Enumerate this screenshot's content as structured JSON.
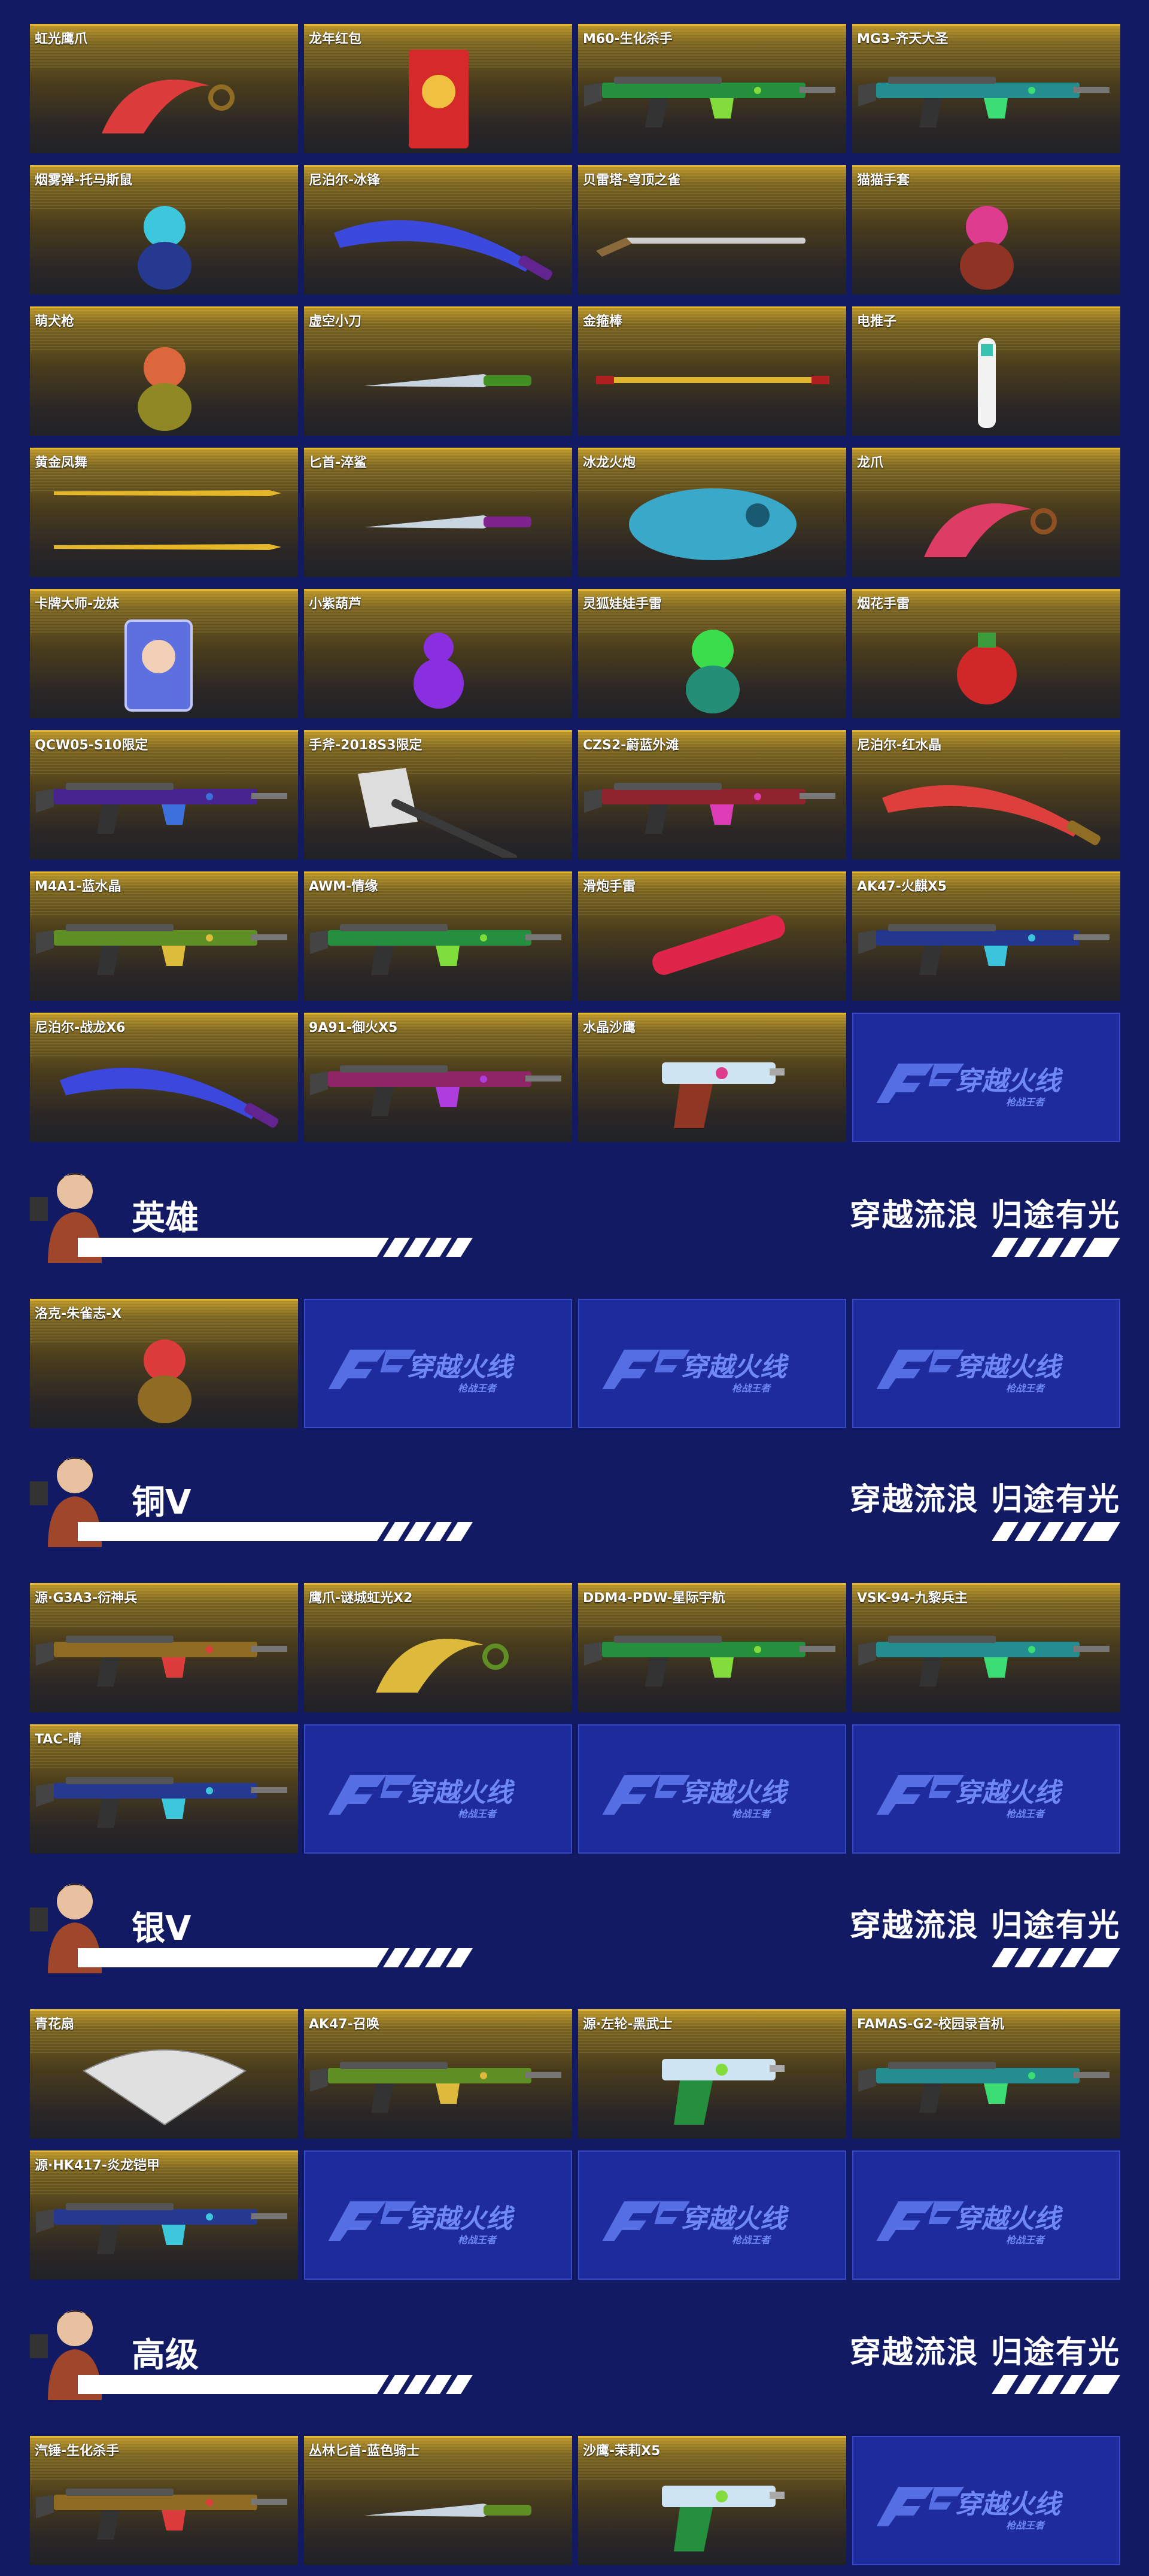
{
  "brand": {
    "logo_text": "穿越火线",
    "logo_subtext": "枪战王者"
  },
  "colors": {
    "background": "#121a63",
    "card_gold": "#e2b832",
    "logo_card": "#1d2b9c"
  },
  "slogan": "穿越流浪 归途有光",
  "top_grid": {
    "items": [
      {
        "name": "虹光鹰爪",
        "art": "karambit-icon"
      },
      {
        "name": "龙年红包",
        "art": "red-envelope-icon"
      },
      {
        "name": "M60-生化杀手",
        "art": "machine-gun-icon"
      },
      {
        "name": "MG3-齐天大圣",
        "art": "machine-gun-icon"
      },
      {
        "name": "烟雾弹-托马斯鼠",
        "art": "mouse-grenade-icon"
      },
      {
        "name": "尼泊尔-冰锋",
        "art": "kukri-icon"
      },
      {
        "name": "贝雷塔-穹顶之雀",
        "art": "shotgun-icon"
      },
      {
        "name": "猫猫手套",
        "art": "cat-paw-icon"
      },
      {
        "name": "萌犬枪",
        "art": "dog-gun-icon"
      },
      {
        "name": "虚空小刀",
        "art": "knife-icon"
      },
      {
        "name": "金箍棒",
        "art": "staff-icon"
      },
      {
        "name": "电推子",
        "art": "clipper-icon"
      },
      {
        "name": "黄金凤舞",
        "art": "golden-spears-icon"
      },
      {
        "name": "匕首-淬鲨",
        "art": "dagger-icon"
      },
      {
        "name": "冰龙火炮",
        "art": "dragon-cannon-icon"
      },
      {
        "name": "龙爪",
        "art": "claw-icon"
      },
      {
        "name": "卡牌大师-龙妹",
        "art": "character-card-icon"
      },
      {
        "name": "小紫葫芦",
        "art": "gourd-icon"
      },
      {
        "name": "灵狐娃娃手雷",
        "art": "doll-icon"
      },
      {
        "name": "烟花手雷",
        "art": "firework-grenade-icon"
      },
      {
        "name": "QCW05-S10限定",
        "art": "smg-icon"
      },
      {
        "name": "手斧-2018S3限定",
        "art": "axe-icon"
      },
      {
        "name": "CZS2-蔚蓝外滩",
        "art": "smg-icon"
      },
      {
        "name": "尼泊尔-红水晶",
        "art": "kukri-icon"
      },
      {
        "name": "M4A1-蓝水晶",
        "art": "rifle-icon"
      },
      {
        "name": "AWM-情缘",
        "art": "sniper-icon"
      },
      {
        "name": "滑炮手雷",
        "art": "fire-stick-icon"
      },
      {
        "name": "AK47-火麒X5",
        "art": "rifle-icon"
      },
      {
        "name": "尼泊尔-战龙X6",
        "art": "kukri-icon"
      },
      {
        "name": "9A91-御火X5",
        "art": "smg-icon"
      },
      {
        "name": "水晶沙鹰",
        "art": "pistol-icon"
      },
      {
        "name": "",
        "art": "cf-logo-icon"
      }
    ]
  },
  "sections": [
    {
      "title": "英雄",
      "items": [
        {
          "name": "洛克-朱雀志-X",
          "art": "hero-character-icon"
        },
        {
          "name": "",
          "art": "cf-logo-icon"
        },
        {
          "name": "",
          "art": "cf-logo-icon"
        },
        {
          "name": "",
          "art": "cf-logo-icon"
        }
      ]
    },
    {
      "title": "铜V",
      "items": [
        {
          "name": "源·G3A3-衍神兵",
          "art": "rifle-icon"
        },
        {
          "name": "鹰爪-谜城虹光X2",
          "art": "karambit-icon"
        },
        {
          "name": "DDM4-PDW-星际宇航",
          "art": "smg-icon"
        },
        {
          "name": "VSK-94-九黎兵主",
          "art": "rifle-icon"
        },
        {
          "name": "TAC-晴",
          "art": "sniper-icon"
        },
        {
          "name": "",
          "art": "cf-logo-icon"
        },
        {
          "name": "",
          "art": "cf-logo-icon"
        },
        {
          "name": "",
          "art": "cf-logo-icon"
        }
      ]
    },
    {
      "title": "银V",
      "items": [
        {
          "name": "青花扇",
          "art": "fan-icon"
        },
        {
          "name": "AK47-召唤",
          "art": "rifle-icon"
        },
        {
          "name": "源·左轮-黑武士",
          "art": "revolver-icon"
        },
        {
          "name": "FAMAS-G2-校园录音机",
          "art": "rifle-icon"
        },
        {
          "name": "源·HK417-炎龙铠甲",
          "art": "rifle-icon"
        },
        {
          "name": "",
          "art": "cf-logo-icon"
        },
        {
          "name": "",
          "art": "cf-logo-icon"
        },
        {
          "name": "",
          "art": "cf-logo-icon"
        }
      ]
    },
    {
      "title": "高级",
      "items": [
        {
          "name": "汽锤-生化杀手",
          "art": "heavy-gun-icon"
        },
        {
          "name": "丛林匕首-蓝色骑士",
          "art": "dagger-icon"
        },
        {
          "name": "沙鹰-茉莉X5",
          "art": "pistol-icon"
        },
        {
          "name": "",
          "art": "cf-logo-icon"
        }
      ]
    }
  ]
}
